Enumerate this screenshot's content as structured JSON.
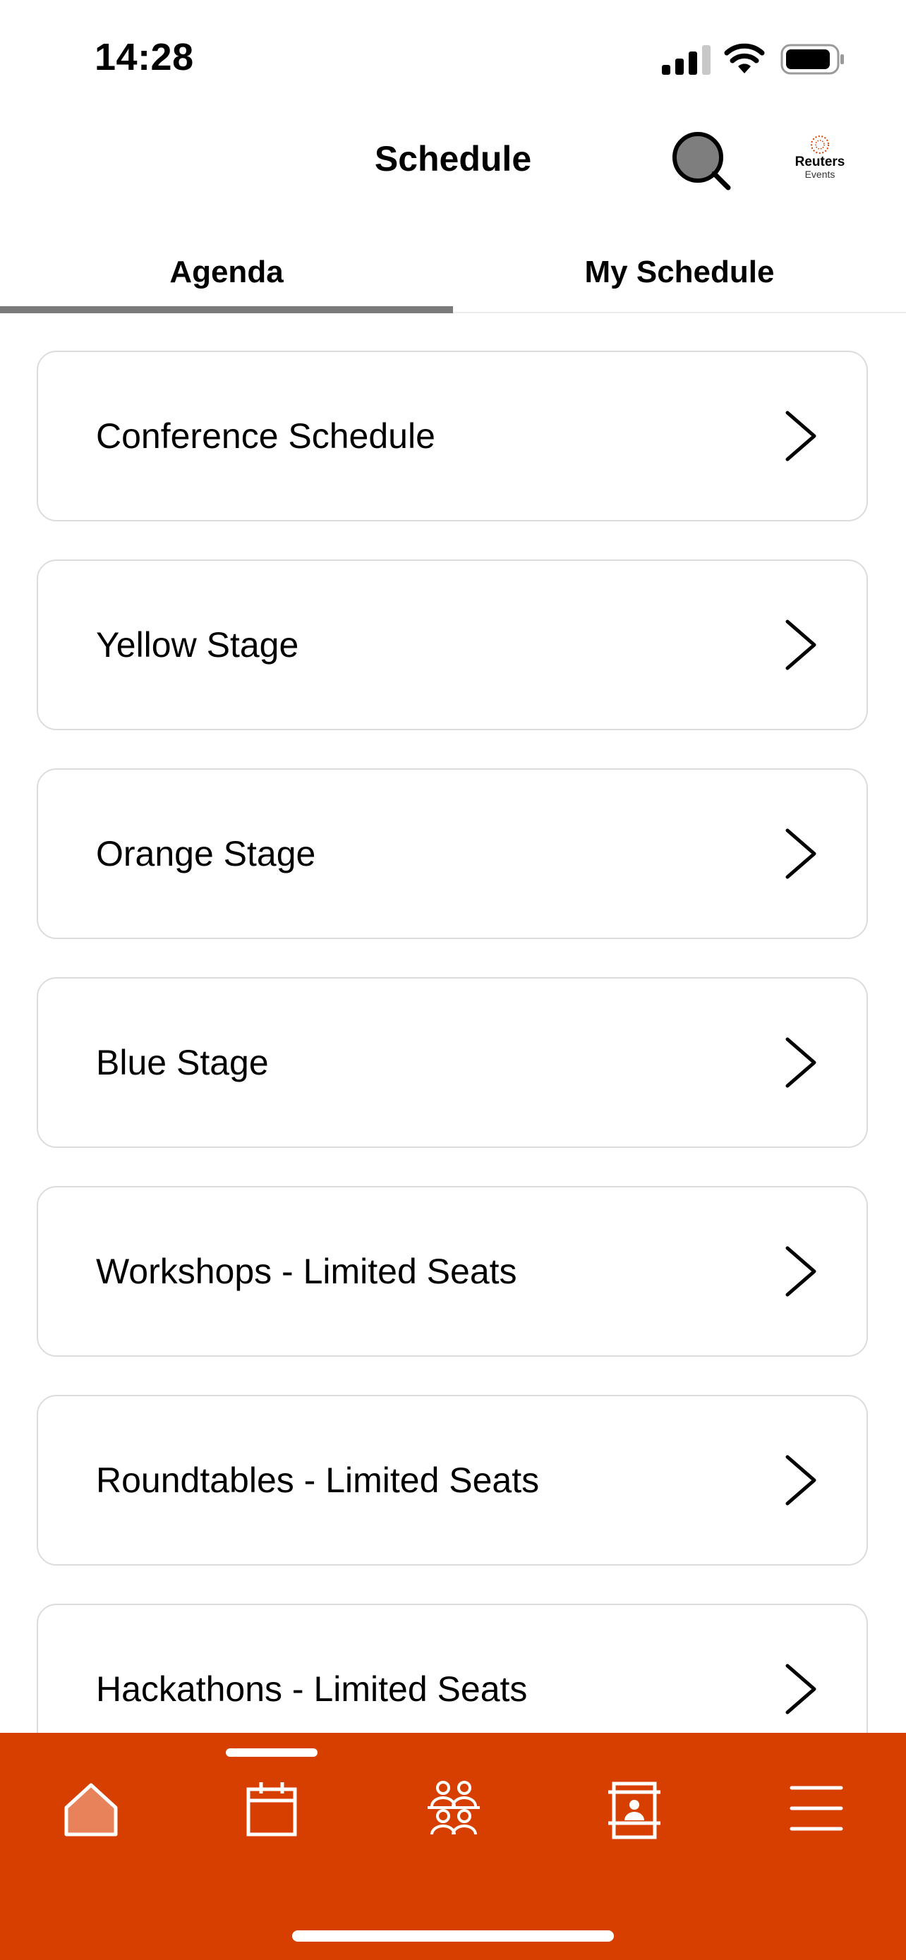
{
  "status_bar": {
    "time": "14:28"
  },
  "header": {
    "title": "Schedule",
    "logo_line1": "Reuters",
    "logo_line2": "Events"
  },
  "tabs": [
    {
      "label": "Agenda",
      "active": true
    },
    {
      "label": "My Schedule",
      "active": false
    }
  ],
  "schedule_items": [
    {
      "label": "Conference Schedule"
    },
    {
      "label": "Yellow Stage"
    },
    {
      "label": "Orange Stage"
    },
    {
      "label": "Blue Stage"
    },
    {
      "label": "Workshops - Limited Seats"
    },
    {
      "label": "Roundtables - Limited Seats"
    },
    {
      "label": "Hackathons - Limited Seats"
    }
  ],
  "bottom_nav": {
    "active": "schedule",
    "items": [
      "home-icon",
      "calendar-icon",
      "people-icon",
      "exhibitor-icon",
      "menu-icon"
    ]
  },
  "colors": {
    "brand": "#d63f00",
    "home_fill": "#e8825a"
  }
}
